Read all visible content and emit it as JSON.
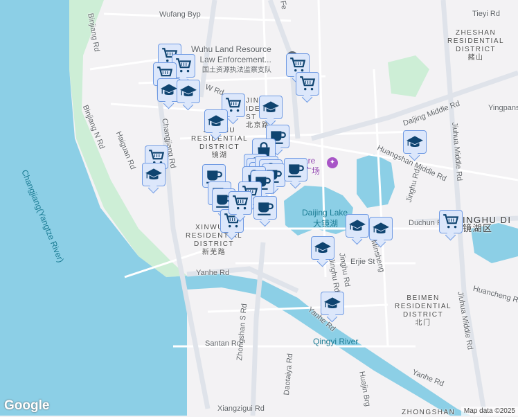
{
  "colors": {
    "water": "#8ccfe6",
    "park": "#cdeed6",
    "road": "#ffffff",
    "major_road": "#dfe3ea",
    "marker_fill": "#dce7fb",
    "marker_border": "#6f9ae3",
    "icon": "#0f4470"
  },
  "roads": {
    "wufang": "Wufang Byp",
    "binjiang": "Binjiang Rd",
    "binjiang_n": "Binjiang N Rd",
    "haiguan": "Haiguan Rd",
    "changjiang": "Changjiang Rd",
    "w_rd": "W Rd",
    "daijing_middle": "Daijing Middle Rd",
    "yingpan": "Yingpanshan",
    "huangshan_middle": "Huangshan Middle Rd",
    "jinghu": "Jinghu Rd",
    "jiuhua_middle_top": "Jiuhua Middle Rd",
    "jiuhua_middle_bottom": "Jiuhua Middle Rd",
    "duchun": "Duchun Rd",
    "minsheng": "Minsheng",
    "jinghu_s": "Jinghu Rd",
    "yanhe_w": "Yanhe Rd",
    "yanhe_mid": "Yanhe Rd",
    "yanhe_e": "Yanhe Rd",
    "erjie": "Erjie St",
    "huancheng": "Huancheng Rd",
    "santan": "Santan Rd",
    "zhongshan_s": "Zhongshan S Rd",
    "daotaiya": "Daotaiya Rd",
    "huajin": "Huajin Brg",
    "xiangzigui": "Xiangzigui Rd",
    "tieyi": "Tieyi Rd",
    "fe": "Fe",
    "jinghu_rd_s": "Jinghu Rd"
  },
  "districts": {
    "zheshan": {
      "en": "ZHESHAN\nRESIDENTIAL\nDISTRICT",
      "zh": "赭山"
    },
    "jinghu": {
      "en": "JINGHU\nRESIDENTIAL\nDISTRICT",
      "zh": "镜湖"
    },
    "xinwu": {
      "en": "XINWU R\nRESIDENTIAL\nDISTRICT",
      "zh": "新芜路"
    },
    "beimen": {
      "en": "BEIMEN\nRESIDENTIAL\nDISTRICT",
      "zh": "北门"
    },
    "beijing": {
      "en": "JING\nIDE\nST",
      "zh": "北京路"
    },
    "jinghu_east": {
      "en": "INGHU DI",
      "zh": "镜湖区"
    },
    "zhongshan": {
      "en": "ZHONGSHAN"
    }
  },
  "water": {
    "yangtze": "Changjiang(Yangtze River)",
    "daijing_en": "Daijing Lake",
    "daijing_zh": "大镜湖",
    "qingyi": "Qingyi River"
  },
  "poi": {
    "wuhu_land_1": "Wuhu Land Resource",
    "wuhu_land_2": "Law Enforcement...",
    "wuhu_land_zh": "国土资源执法监察支队",
    "square": "are",
    "square_zh": "广场"
  },
  "markers": [
    "cart",
    "cart",
    "cart",
    "cap",
    "cap",
    "cart",
    "cap",
    "cap",
    "coffee",
    "cart",
    "cart",
    "cap",
    "cart",
    "cap",
    "coffee",
    "coffee",
    "bag",
    "bag",
    "bag",
    "cart",
    "bag",
    "bag",
    "coffee",
    "bag",
    "coffee",
    "coffee",
    "cart",
    "coffee",
    "cart",
    "cart",
    "cap",
    "cap",
    "cap",
    "cap",
    "cart",
    "coffee"
  ],
  "footer": {
    "logo": "Google",
    "attribution": "Map data ©2025"
  }
}
